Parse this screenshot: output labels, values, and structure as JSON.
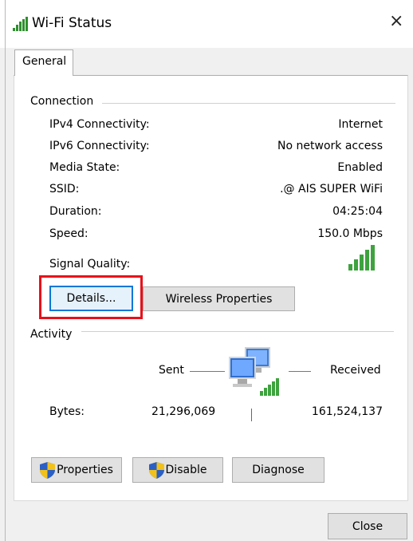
{
  "window": {
    "title": "Wi-Fi Status",
    "close_symbol": "×",
    "title_icon": "wifi-signal-icon"
  },
  "tabs": [
    {
      "label": "General",
      "selected": true
    }
  ],
  "connection": {
    "group_label": "Connection",
    "rows": [
      {
        "label": "IPv4 Connectivity:",
        "value": "Internet"
      },
      {
        "label": "IPv6 Connectivity:",
        "value": "No network access"
      },
      {
        "label": "Media State:",
        "value": "Enabled"
      },
      {
        "label": "SSID:",
        "value": ".@ AIS SUPER WiFi"
      },
      {
        "label": "Duration:",
        "value": "04:25:04"
      },
      {
        "label": "Speed:",
        "value": "150.0 Mbps"
      }
    ],
    "signal_quality_label": "Signal Quality:",
    "signal_quality_bars": 5,
    "details_button": "Details...",
    "wireless_properties_button": "Wireless Properties"
  },
  "activity": {
    "group_label": "Activity",
    "sent_label": "Sent",
    "received_label": "Received",
    "bytes_label": "Bytes:",
    "bytes_sent": "21,296,069",
    "bytes_received": "161,524,137",
    "network_icon": "network-computers-icon"
  },
  "actions": {
    "properties_button": "Properties",
    "disable_button": "Disable",
    "diagnose_button": "Diagnose",
    "shield_icon": "uac-shield-icon"
  },
  "footer": {
    "close_button": "Close"
  },
  "colors": {
    "highlight": "#e8101a",
    "focus": "#0078d7",
    "signal_green": "#3ea33e"
  }
}
